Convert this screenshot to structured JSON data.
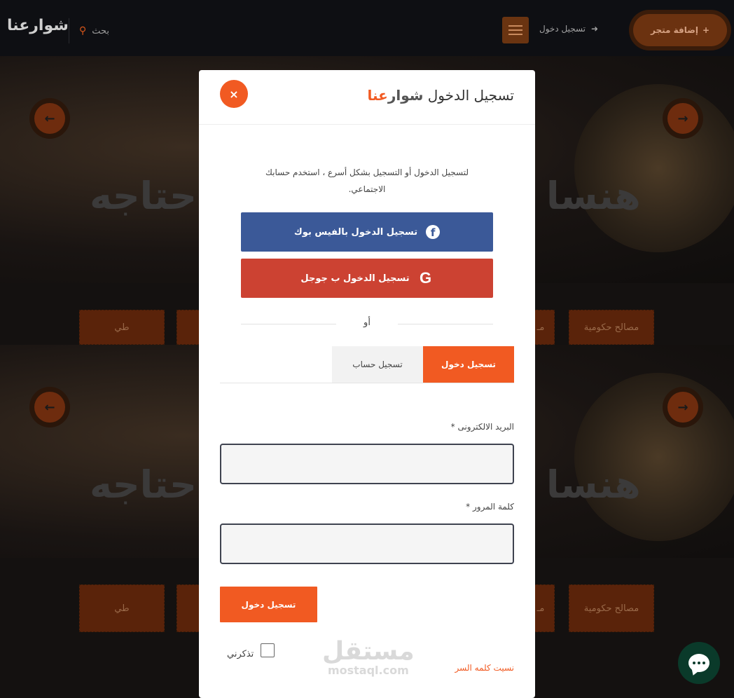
{
  "navbar": {
    "logo_text": "شوارعنا",
    "search_placeholder": "بحث",
    "login_label": "تسجيل دخول",
    "add_store_label": "إضافة متجر"
  },
  "hero": {
    "slide_title_right": "هنسا",
    "slide_title_left": "حتاجه",
    "categories": [
      "طي",
      "مصالح حكومية",
      "مـ"
    ]
  },
  "modal": {
    "title_prefix": "تسجيل الدخول",
    "brand_part1": "شوار",
    "brand_part2": "عنا",
    "close_symbol": "×",
    "intro_text": "لتسجيل الدخول أو التسجيل بشكل أسرع ، استخدم حسابك الاجتماعي.",
    "facebook_label": "تسجيل الدخول بالفيس بوك",
    "google_label": "تسجيل الدخول ب جوجل",
    "or_text": "أو",
    "tabs": {
      "login": "تسجيل دخول",
      "register": "تسجيل حساب"
    },
    "email_label": "البريد الالكترونى",
    "password_label": "كلمة المرور",
    "required_mark": "*",
    "email_value": "",
    "password_value": "",
    "submit_label": "تسجيل دخول",
    "remember_label": "تذكرني",
    "forgot_label": "نسيت كلمه السر"
  },
  "watermark": {
    "arabic": "مستقل",
    "latin": "mostaql.com"
  },
  "colors": {
    "accent": "#f15a22",
    "facebook": "#3b5998",
    "google": "#cc4232"
  }
}
